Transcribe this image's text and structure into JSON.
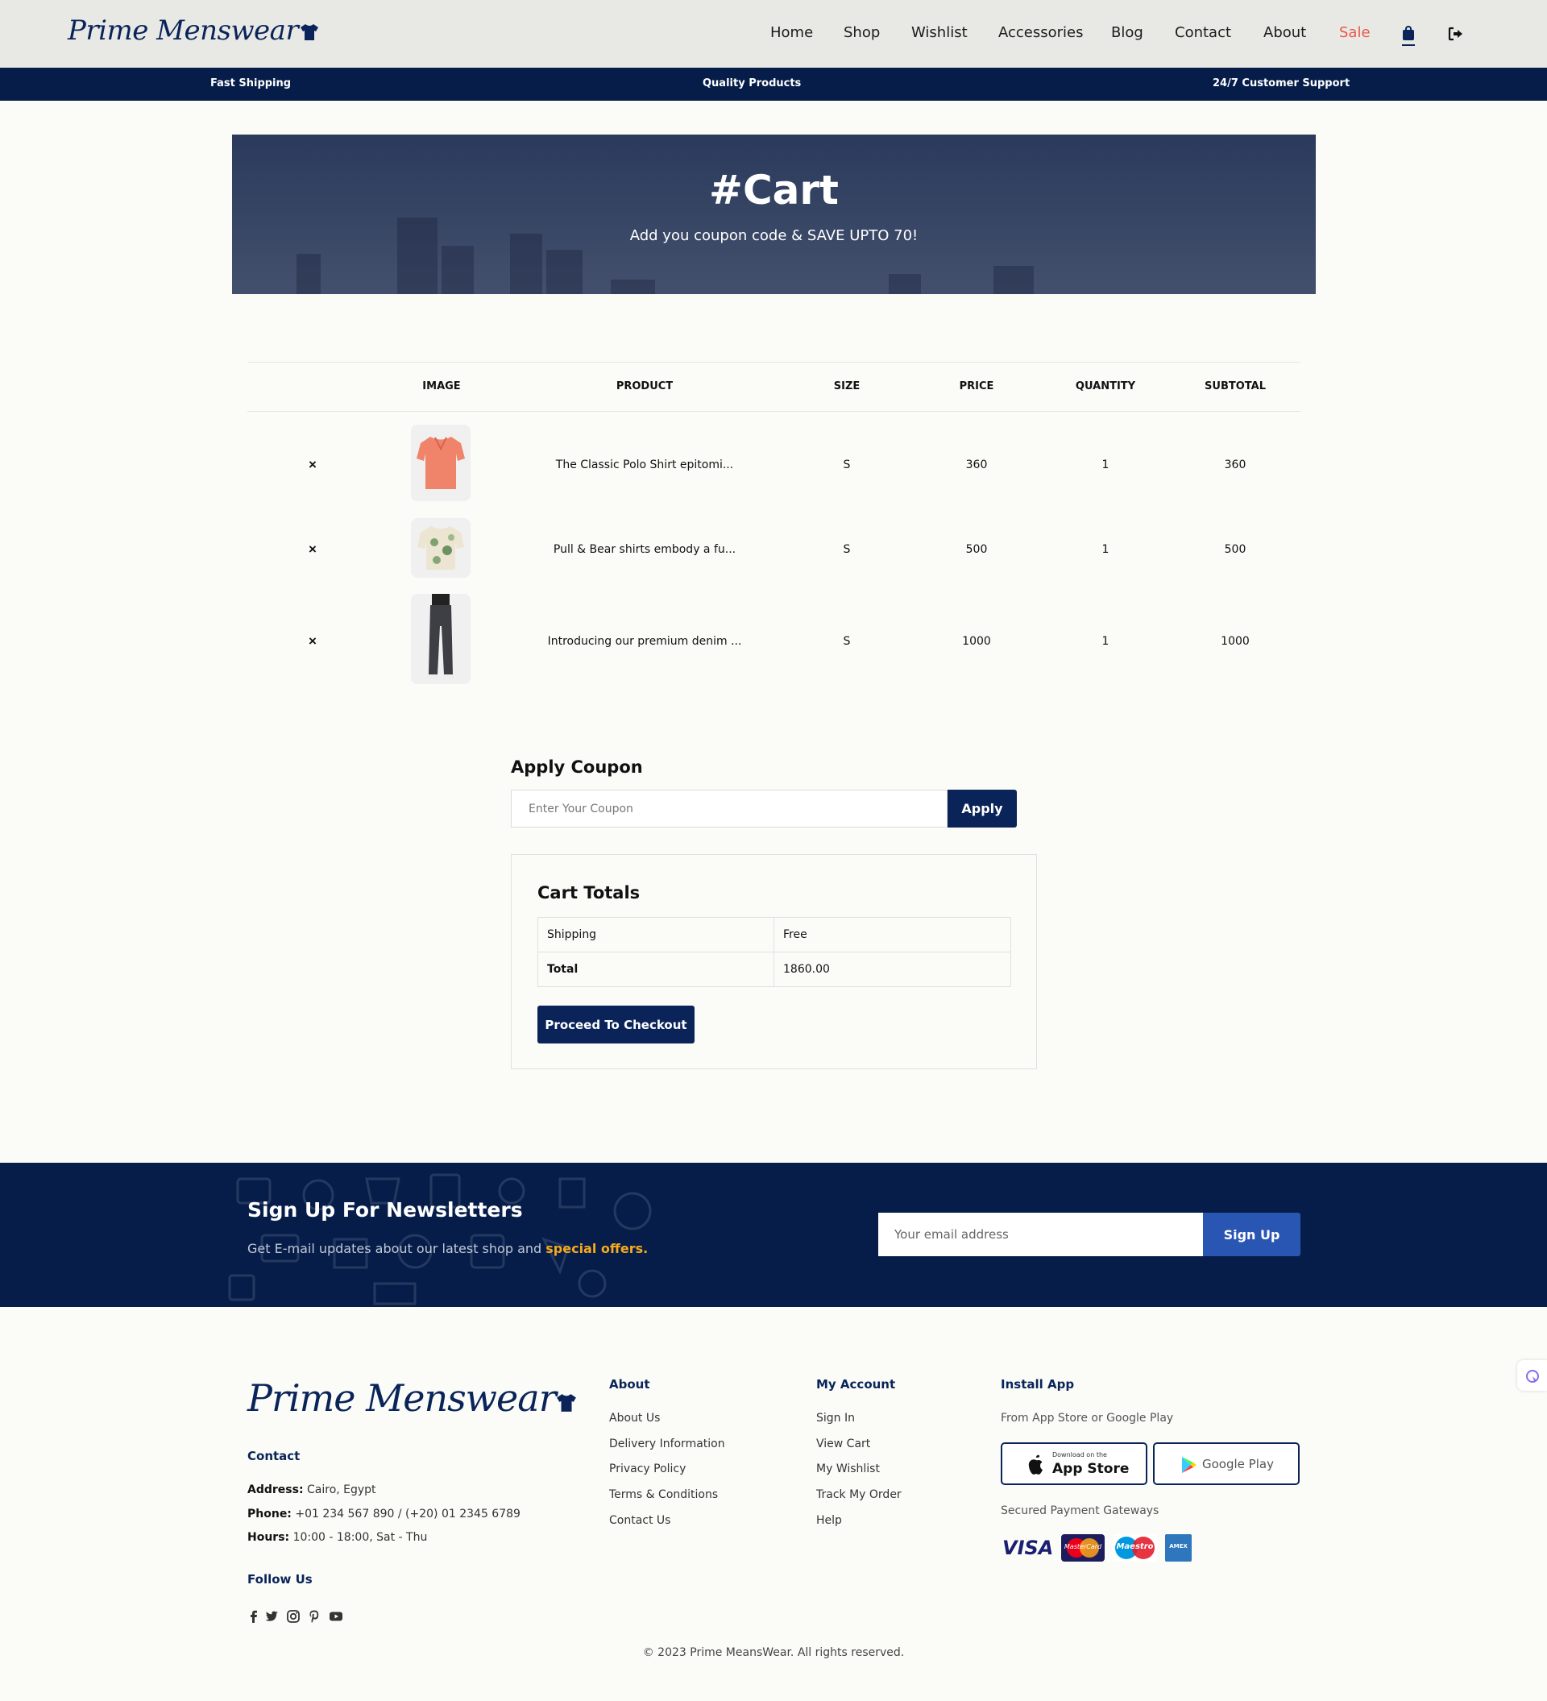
{
  "header": {
    "logo": "Prime Menswear",
    "nav": [
      "Home",
      "Shop",
      "Wishlist",
      "Accessories",
      "Blog",
      "Contact",
      "About",
      "Sale"
    ]
  },
  "features": [
    "Fast Shipping",
    "Quality Products",
    "24/7 Customer Support"
  ],
  "hero": {
    "title": "#Cart",
    "subtitle": "Add you coupon code & SAVE UPTO 70!"
  },
  "cart": {
    "columns": [
      "IMAGE",
      "PRODUCT",
      "SIZE",
      "PRICE",
      "QUANTITY",
      "SUBTOTAL"
    ],
    "remove_symbol": "×",
    "items": [
      {
        "product": "The Classic Polo Shirt epitomi...",
        "size": "S",
        "price": "360",
        "quantity": "1",
        "subtotal": "360"
      },
      {
        "product": "Pull & Bear shirts embody a fu...",
        "size": "S",
        "price": "500",
        "quantity": "1",
        "subtotal": "500"
      },
      {
        "product": "Introducing our premium denim ...",
        "size": "S",
        "price": "1000",
        "quantity": "1",
        "subtotal": "1000"
      }
    ]
  },
  "coupon": {
    "title": "Apply Coupon",
    "placeholder": "Enter Your Coupon",
    "button": "Apply"
  },
  "totals": {
    "title": "Cart Totals",
    "shipping_label": "Shipping",
    "shipping_value": "Free",
    "total_label": "Total",
    "total_value": "1860.00",
    "checkout_button": "Proceed To Checkout"
  },
  "newsletter": {
    "title": "Sign Up For Newsletters",
    "text": "Get E-mail updates about our latest shop and ",
    "highlight": "special offers.",
    "placeholder": "Your email address",
    "button": "Sign Up"
  },
  "footer": {
    "logo": "Prime Menswear",
    "contact_title": "Contact",
    "address_label": "Address:",
    "address": " Cairo, Egypt",
    "phone_label": "Phone:",
    "phone": " +01 234 567 890 / (+20) 01 2345 6789",
    "hours_label": "Hours:",
    "hours": " 10:00 - 18:00, Sat - Thu",
    "follow_title": "Follow Us",
    "about_title": "About",
    "about_links": [
      "About Us",
      "Delivery Information",
      "Privacy Policy",
      "Terms & Conditions",
      "Contact Us"
    ],
    "account_title": "My Account",
    "account_links": [
      "Sign In",
      "View Cart",
      "My Wishlist",
      "Track My Order",
      "Help"
    ],
    "app_title": "Install App",
    "app_text": "From App Store or Google Play",
    "appstore_small": "Download on the",
    "appstore_big": "App Store",
    "googleplay": "Google Play",
    "payment_text": "Secured Payment Gateways",
    "payments": [
      "VISA",
      "MasterCard",
      "Maestro",
      "AMEX"
    ],
    "copyright": "© 2023 Prime MeansWear. All rights reserved."
  },
  "colors": {
    "navy": "#061d4a",
    "brand": "#0a2459",
    "sale": "#e8574b",
    "accent": "#f7a91d",
    "signup": "#2a56b3"
  }
}
